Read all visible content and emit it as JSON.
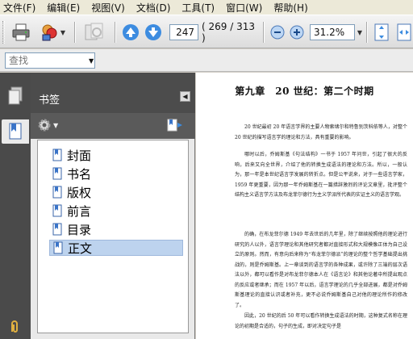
{
  "menu": [
    "文件(F)",
    "编辑(E)",
    "视图(V)",
    "文档(D)",
    "工具(T)",
    "窗口(W)",
    "帮助(H)"
  ],
  "toolbar": {
    "current_page": "247",
    "page_count": "( 269 / 313 )",
    "zoom": "31.2%"
  },
  "search": {
    "placeholder": "查找"
  },
  "bookmarks": {
    "title": "书签",
    "items": [
      "封面",
      "书名",
      "版权",
      "前言",
      "目录",
      "正文"
    ],
    "selected_index": 5
  },
  "document": {
    "heading": "第九章　20 世纪：第二个时期",
    "paragraphs": [
      "20 世纪最初 20 年语言学界的主要人物索绪尔和特鲁别茨科依等人，对整个 20 世纪的描写语言学的理论和方法，具有重要的影响。",
      "哪时以后，乔姆斯基《句法结构》一书于 1957 年问世，引起了很大的反响，后来又向全世界，介绍了他的转换生成语法的理论和方法。所以，一般认为，那一年是本世纪语言学发展的转折点。但是公平说来，对于一些语言学家，1959 年更重要，因为那一年乔姆斯基在一篇措辞激烈的评论文章里，批评整个结构主义语言学方法及布龙菲尔德行为主义学派所代表的实证主义的语言学观。",
      "的确，在布龙菲尔德 1949 年去世后的几年里，除了继续按照他的理论进行研究的人以外，语言学理论和其他研究者都对直接形式和大规模像正体为自己设立的原则。然而，有意向后来称为“布龙菲尔德派”的理论的整个哲学基础提出挑战的，则是乔姆斯基。上一章谈到的语言学的各种成果，或许除了三端的层次语法以外，都可以看作是对布龙菲尔德本人在《语言论》和其他论著中所提出观点的反应或者继承；而在 1957 年以后，语言学理论的几乎全部进展，都是对乔姆斯基理论的直接认识或者补充，更不必说乔姆斯基自己对他的理论所作的修改了。",
      "因此，20 世纪的后 50 年可以看作转换生成语法的时期，这种复式名称在理论的初期是合适的，句子的生成，即对决定句子是"
    ]
  }
}
